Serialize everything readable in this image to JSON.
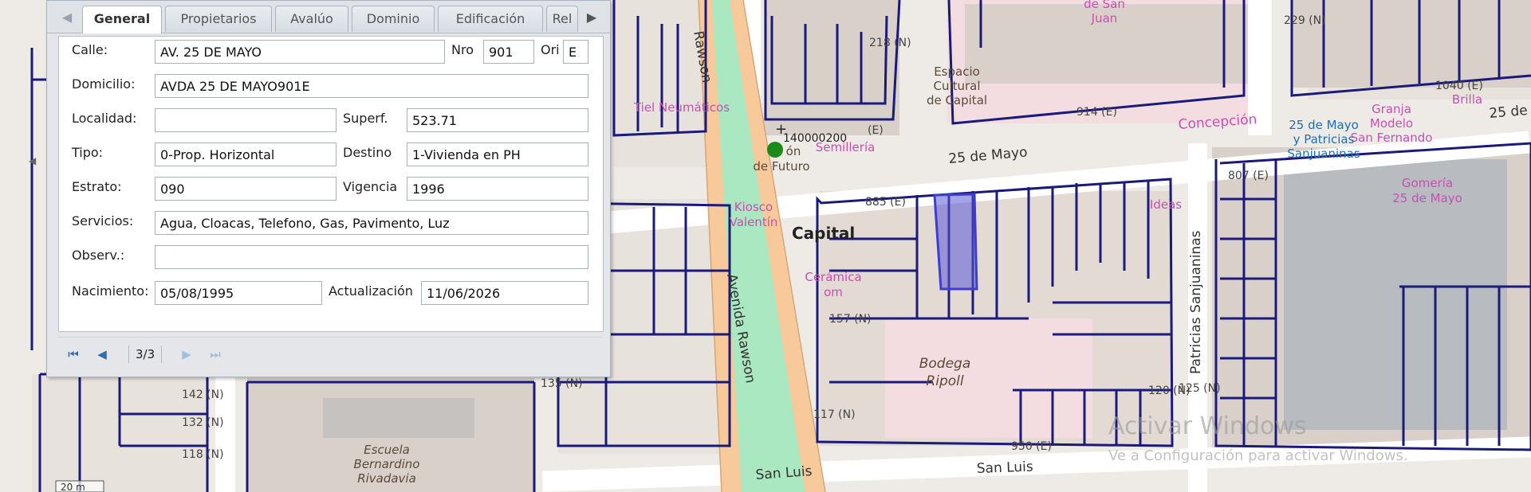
{
  "tabs": {
    "prev": "◀",
    "next": "▶",
    "items": [
      "General",
      "Propietarios",
      "Avalúo",
      "Dominio",
      "Edificación",
      "Rel"
    ]
  },
  "form": {
    "calle_label": "Calle:",
    "calle_value": "AV. 25 DE MAYO",
    "nro_label": "Nro",
    "nro_value": "901",
    "ori_label": "Ori",
    "ori_value": "E",
    "domicilio_label": "Domicilio:",
    "domicilio_value": "AVDA 25 DE MAYO901E",
    "localidad_label": "Localidad:",
    "localidad_value": "",
    "superf_label": "Superf.",
    "superf_value": "523.71",
    "tipo_label": "Tipo:",
    "tipo_value": "0-Prop. Horizontal",
    "destino_label": "Destino",
    "destino_value": "1-Vivienda en PH",
    "estrato_label": "Estrato:",
    "estrato_value": "090",
    "vigencia_label": "Vigencia",
    "vigencia_value": "1996",
    "servicios_label": "Servicios:",
    "servicios_value": "Agua, Cloacas, Telefono, Gas, Pavimento, Luz",
    "observ_label": "Observ.:",
    "observ_value": "",
    "nacimiento_label": "Nacimiento:",
    "nacimiento_value": "05/08/1995",
    "actualizacion_label": "Actualización",
    "actualizacion_value": "11/06/2026"
  },
  "pager": {
    "first": "⏮",
    "prev": "◀",
    "info": "3/3",
    "next": "▶",
    "last": "⏭"
  },
  "map": {
    "streets": {
      "rawson_top": "Rawson",
      "avenida_rawson": "Avenida Rawson",
      "mayo_25": "25 de Mayo",
      "mayo_25_right": "25 de",
      "san_luis_a": "San Luis",
      "san_luis_b": "San Luis",
      "patricias": "Patricias Sanjuaninas",
      "concepcion": "Concepción"
    },
    "pois": {
      "tiel": "Tiel Neumáticos",
      "espacio1": "Espacio",
      "espacio2": "Cultural",
      "espacio3": "de Capital",
      "de_san": "de San",
      "juan": "Juan",
      "semilleria": "Semillería",
      "futuro1": "ón",
      "futuro2": "de Futuro",
      "kiosco1": "Kiosco",
      "kiosco2": "Valentín",
      "capital": "Capital",
      "ceramica1": "Cerámica",
      "ceramica2": "om",
      "bodega1": "Bodega",
      "bodega2": "Ripoll",
      "ideas": "Ideas",
      "mayo_pat1": "25 de Mayo",
      "mayo_pat2": "y Patricias",
      "mayo_pat3": "Sanjuaninas",
      "granja1": "Granja",
      "granja2": "Modelo",
      "granja3": "San Fernando",
      "brilla": "Brilla",
      "gomeria1": "Gomería",
      "gomeria2": "25 de Mayo",
      "escuela1": "Escuela",
      "escuela2": "Bernardino",
      "escuela3": "Rivadavia"
    },
    "parcel_code": "140000200",
    "numbers": [
      "218 (N)",
      "229 (N)",
      "914 (E)",
      "1040 (E)",
      "807 (E)",
      "885 (E)",
      "157 (N)",
      "142 (N)",
      "132 (N)",
      "118 (N)",
      "135 (N)",
      "117 (N)",
      "120 (N)",
      "125 (N)",
      "(E)",
      "950 (E)"
    ],
    "scale": "20 m",
    "watermark1": "Activar Windows",
    "watermark2": "Ve a Configuración para activar Windows."
  },
  "colors": {
    "road": "#f7c99b",
    "median": "#a9e8c0",
    "parcel": "#1a1a7a",
    "poi": "#c64fb3",
    "block": "#d9d0c9",
    "selected": "#5a5ad8"
  }
}
